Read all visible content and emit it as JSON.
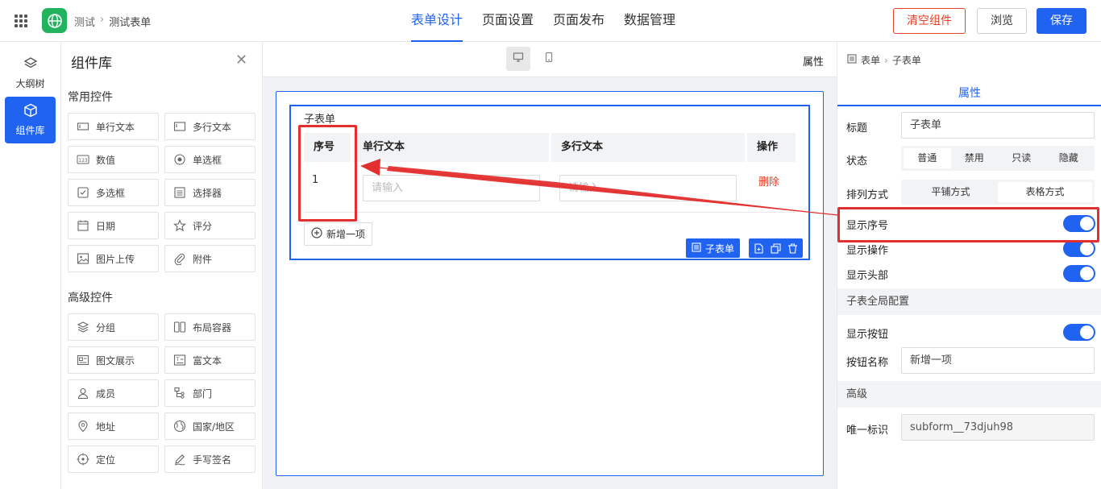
{
  "header": {
    "breadcrumb": [
      "测试",
      "测试表单"
    ],
    "breadcrumb_sep": "›",
    "tabs": [
      {
        "label": "表单设计",
        "active": true
      },
      {
        "label": "页面设置",
        "active": false
      },
      {
        "label": "页面发布",
        "active": false
      },
      {
        "label": "数据管理",
        "active": false
      }
    ],
    "clear_label": "清空组件",
    "preview_label": "浏览",
    "save_label": "保存"
  },
  "leftnav": {
    "items": [
      {
        "label": "大纲树",
        "icon": "layers-icon",
        "active": false
      },
      {
        "label": "组件库",
        "icon": "cube-icon",
        "active": true
      }
    ]
  },
  "library": {
    "title": "组件库",
    "close": "✕",
    "common_title": "常用控件",
    "common": [
      {
        "label": "单行文本",
        "icon": "single-line-text-icon"
      },
      {
        "label": "多行文本",
        "icon": "multi-line-text-icon"
      },
      {
        "label": "数值",
        "icon": "number-icon"
      },
      {
        "label": "单选框",
        "icon": "radio-icon"
      },
      {
        "label": "多选框",
        "icon": "checkbox-icon"
      },
      {
        "label": "选择器",
        "icon": "select-icon"
      },
      {
        "label": "日期",
        "icon": "calendar-icon"
      },
      {
        "label": "评分",
        "icon": "star-icon"
      },
      {
        "label": "图片上传",
        "icon": "image-icon"
      },
      {
        "label": "附件",
        "icon": "paperclip-icon"
      }
    ],
    "advanced_title": "高级控件",
    "advanced": [
      {
        "label": "分组",
        "icon": "group-icon"
      },
      {
        "label": "布局容器",
        "icon": "layout-icon"
      },
      {
        "label": "图文展示",
        "icon": "image-text-icon"
      },
      {
        "label": "富文本",
        "icon": "rich-text-icon"
      },
      {
        "label": "成员",
        "icon": "user-icon"
      },
      {
        "label": "部门",
        "icon": "department-icon"
      },
      {
        "label": "地址",
        "icon": "location-pin-icon"
      },
      {
        "label": "国家/地区",
        "icon": "globe-icon"
      },
      {
        "label": "定位",
        "icon": "crosshair-icon"
      },
      {
        "label": "手写签名",
        "icon": "pen-icon"
      }
    ]
  },
  "canvas": {
    "attr_label": "属性",
    "subform": {
      "label": "子表单",
      "columns": [
        "序号",
        "单行文本",
        "多行文本",
        "操作"
      ],
      "row_number": "1",
      "placeholder": "请输入",
      "delete_label": "删除",
      "add_row_label": "新增一项",
      "tag_label": "子表单"
    }
  },
  "props": {
    "breadcrumb": [
      "表单",
      "子表单"
    ],
    "tab_label": "属性",
    "title_label": "标题",
    "title_value": "子表单",
    "status_label": "状态",
    "status_options": [
      "普通",
      "禁用",
      "只读",
      "隐藏"
    ],
    "status_selected": 0,
    "layout_label": "排列方式",
    "layout_options": [
      "平铺方式",
      "表格方式"
    ],
    "layout_selected": 1,
    "show_index_label": "显示序号",
    "show_index": true,
    "show_ops_label": "显示操作",
    "show_ops": true,
    "show_header_label": "显示头部",
    "show_header": true,
    "global_section": "子表全局配置",
    "show_button_label": "显示按钮",
    "show_button": true,
    "button_name_label": "按钮名称",
    "button_name_value": "新增一项",
    "advanced_section": "高级",
    "uid_label": "唯一标识",
    "uid_value": "subform__73djuh98"
  },
  "colors": {
    "primary": "#1f63f0",
    "danger": "#e0432a",
    "highlight": "#e32f2f",
    "app_logo": "#22b35e"
  }
}
